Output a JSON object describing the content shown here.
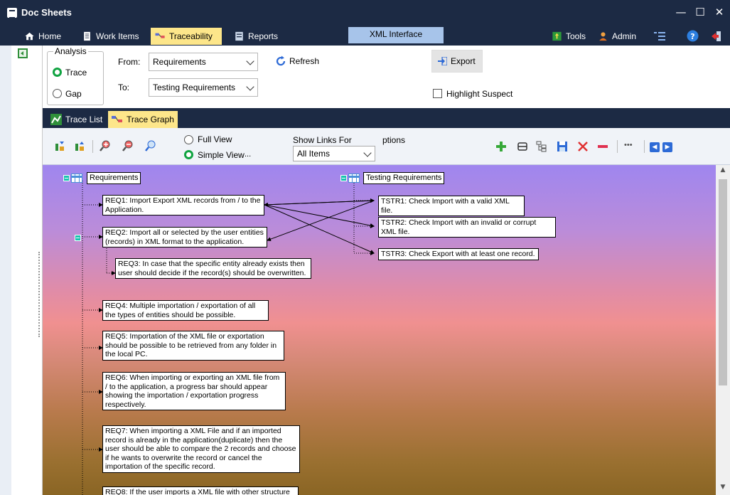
{
  "window": {
    "title": "Doc Sheets",
    "controls": [
      "—",
      "☐",
      "✕"
    ]
  },
  "menu": {
    "tabs": [
      {
        "label": "Home",
        "icon": "home-icon"
      },
      {
        "label": "Work Items",
        "icon": "document-icon"
      },
      {
        "label": "Traceability",
        "icon": "traceability-icon",
        "active": true
      },
      {
        "label": "Reports",
        "icon": "reports-icon"
      }
    ],
    "xml_tab": "XML Interface",
    "tools": "Tools",
    "admin": "Admin"
  },
  "analysis": {
    "group_label": "Analysis",
    "trace_label": "Trace",
    "gap_label": "Gap",
    "selected": "Trace",
    "from_label": "From:",
    "from_value": "Requirements",
    "to_label": "To:",
    "to_value": "Testing Requirements",
    "refresh_label": "Refresh",
    "export_label": "Export",
    "highlight_label": "Highlight Suspect",
    "highlight_checked": false
  },
  "subtabs": [
    {
      "label": "Trace List",
      "active": false
    },
    {
      "label": "Trace Graph",
      "active": true
    }
  ],
  "toolbar": {
    "full_view_label": "Full View",
    "simple_view_label": "Simple View",
    "view_selected": "Simple View",
    "more_label": "...",
    "show_links_label": "Show Links For",
    "show_links_value": "All Items",
    "options_label": "ptions"
  },
  "graph": {
    "left_root": "Requirements",
    "right_root": "Testing Requirements",
    "req1": "REQ1: Import Export XML records from / to the Application.",
    "req2": "REQ2: Import all or selected by the user entities (records) in XML format  to the application.",
    "req3": "REQ3: In case that the specific entity already exists then user should decide if the record(s) should be overwritten.",
    "req4": "REQ4: Multiple importation / exportation of all the types of entities should be possible.",
    "req5": "REQ5: Importation of the XML file or exportation should be possible to be retrieved from any folder in the local PC.",
    "req6": "REQ6: When importing or exporting an XML file from / to the application, a progress bar should appear showing the importation / exportation progress respectively.",
    "req7": "REQ7: When importing a XML File and if an imported record is already in the application(duplicate) then the user should be able to compare the 2 records and choose if he wants to overwrite the record or cancel the importation of the specific record.",
    "req8": "REQ8: If the user imports a XML  file with other structure",
    "tstr1": "TSTR1: Check Import with a valid XML file.",
    "tstr2": "TSTR2: Check Import with an invalid or corrupt XML file.",
    "tstr3": "TSTR3: Check Export with at least one record."
  },
  "colors": {
    "chrome": "#1c2a44",
    "active_tab": "#fde68a",
    "xml_tab": "#a7c4ea",
    "accent_green": "#10a341"
  }
}
